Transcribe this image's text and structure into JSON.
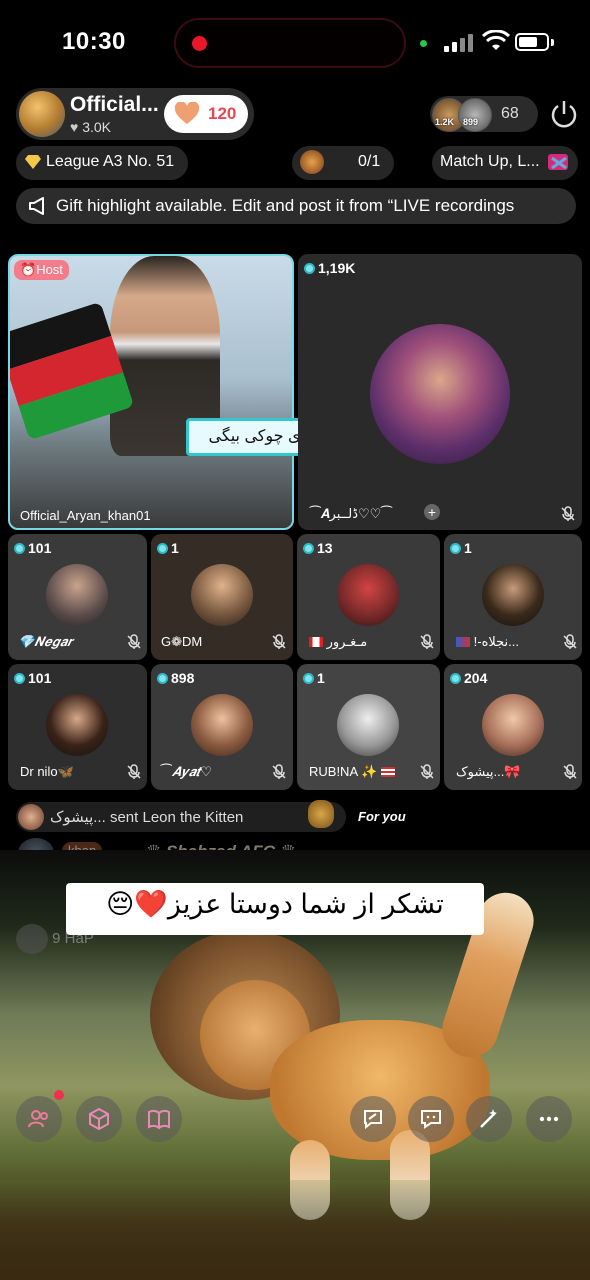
{
  "status_bar": {
    "time": "10:30"
  },
  "host": {
    "name": "Official...",
    "likes": "3.0K",
    "hearts": "120"
  },
  "viewers": {
    "avatar_1_label": "1.2K",
    "avatar_2_label": "899",
    "count": "68"
  },
  "league": {
    "label": "League A3 No.",
    "number": "51"
  },
  "match_progress": "0/1",
  "match_up": "Match Up, L...",
  "announcement": "Gift highlight available. Edit and post it from “LIVE recordings",
  "main_seats": [
    {
      "role": "Host",
      "name": "Official_Aryan_khan01",
      "sticker": "زور داری چوکی بیگی"
    },
    {
      "count": "1,19K",
      "name": "⁀𝑨ڈلــبر♡♡⁀"
    }
  ],
  "seats_row1": [
    {
      "count": "101",
      "name": "💎𝑵𝒆𝒈𝒂𝒓"
    },
    {
      "count": "1",
      "name": "G❁DM"
    },
    {
      "count": "13",
      "name": "مـغـرور"
    },
    {
      "count": "1",
      "name": "!-نجلاه..."
    }
  ],
  "seats_row2": [
    {
      "count": "101",
      "name": "Dr nilo🦋"
    },
    {
      "count": "898",
      "name": "⁀𝑨𝒚𝒂𝒕♡"
    },
    {
      "count": "1",
      "name": "RUB!NA ✨"
    },
    {
      "count": "204",
      "name": "پیشوک..."
    }
  ],
  "chat": {
    "gift_sender": "پیشوک...",
    "gift_text": "sent Leon the Kitten",
    "gift_tag": "For you",
    "msg_badge": "khan",
    "msg_user": "♛ Shahzad AFG ♛",
    "msg_faded_tail": "9 HaP"
  },
  "caption": "تشکر از شما دوستا عزیز❤️😔",
  "colors": {
    "teal": "#2fb9c6",
    "heart": "#e8474f",
    "record": "#e8182a"
  }
}
